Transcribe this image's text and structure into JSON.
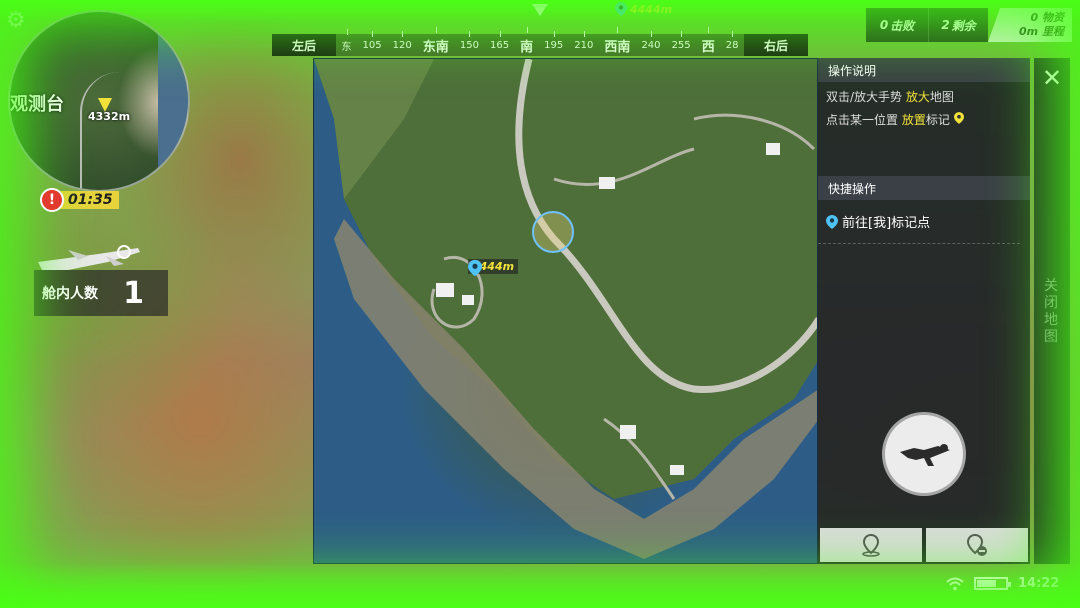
{
  "compass": {
    "left_label": "左后",
    "right_label": "右后",
    "ticks": [
      "东",
      "105",
      "120",
      "东南",
      "150",
      "165",
      "南",
      "195",
      "210",
      "西南",
      "240",
      "255",
      "西",
      "28"
    ],
    "marker_distance": "4444m"
  },
  "stats": {
    "kills_value": "0",
    "kills_label": "击败",
    "remaining_value": "2",
    "remaining_label": "剩余",
    "supplies_value": "0",
    "supplies_label": "物资",
    "mileage_value": "0m",
    "mileage_label": "里程"
  },
  "minimap": {
    "location_label": "观测台",
    "distance": "4332m"
  },
  "timer": {
    "alert": "!",
    "time": "01:35"
  },
  "plane": {
    "label": "舱内人数",
    "count": "1"
  },
  "map": {
    "marker_distance": "4444m"
  },
  "panel": {
    "instructions_title": "操作说明",
    "instr_line1_prefix": "双击/放大手势 ",
    "instr_line1_highlight": "放大",
    "instr_line1_suffix": "地图",
    "instr_line2_prefix": "点击某一位置 ",
    "instr_line2_highlight": "放置",
    "instr_line2_suffix": "标记",
    "quick_title": "快捷操作",
    "goto_marker": "前往[我]标记点"
  },
  "close": {
    "icon": "✕",
    "label": "关闭地图"
  },
  "status": {
    "time": "14:22"
  },
  "colors": {
    "accent_yellow": "#f3e23a",
    "poison_green": "#5aff1e",
    "marker_blue": "#4fc3f7"
  }
}
